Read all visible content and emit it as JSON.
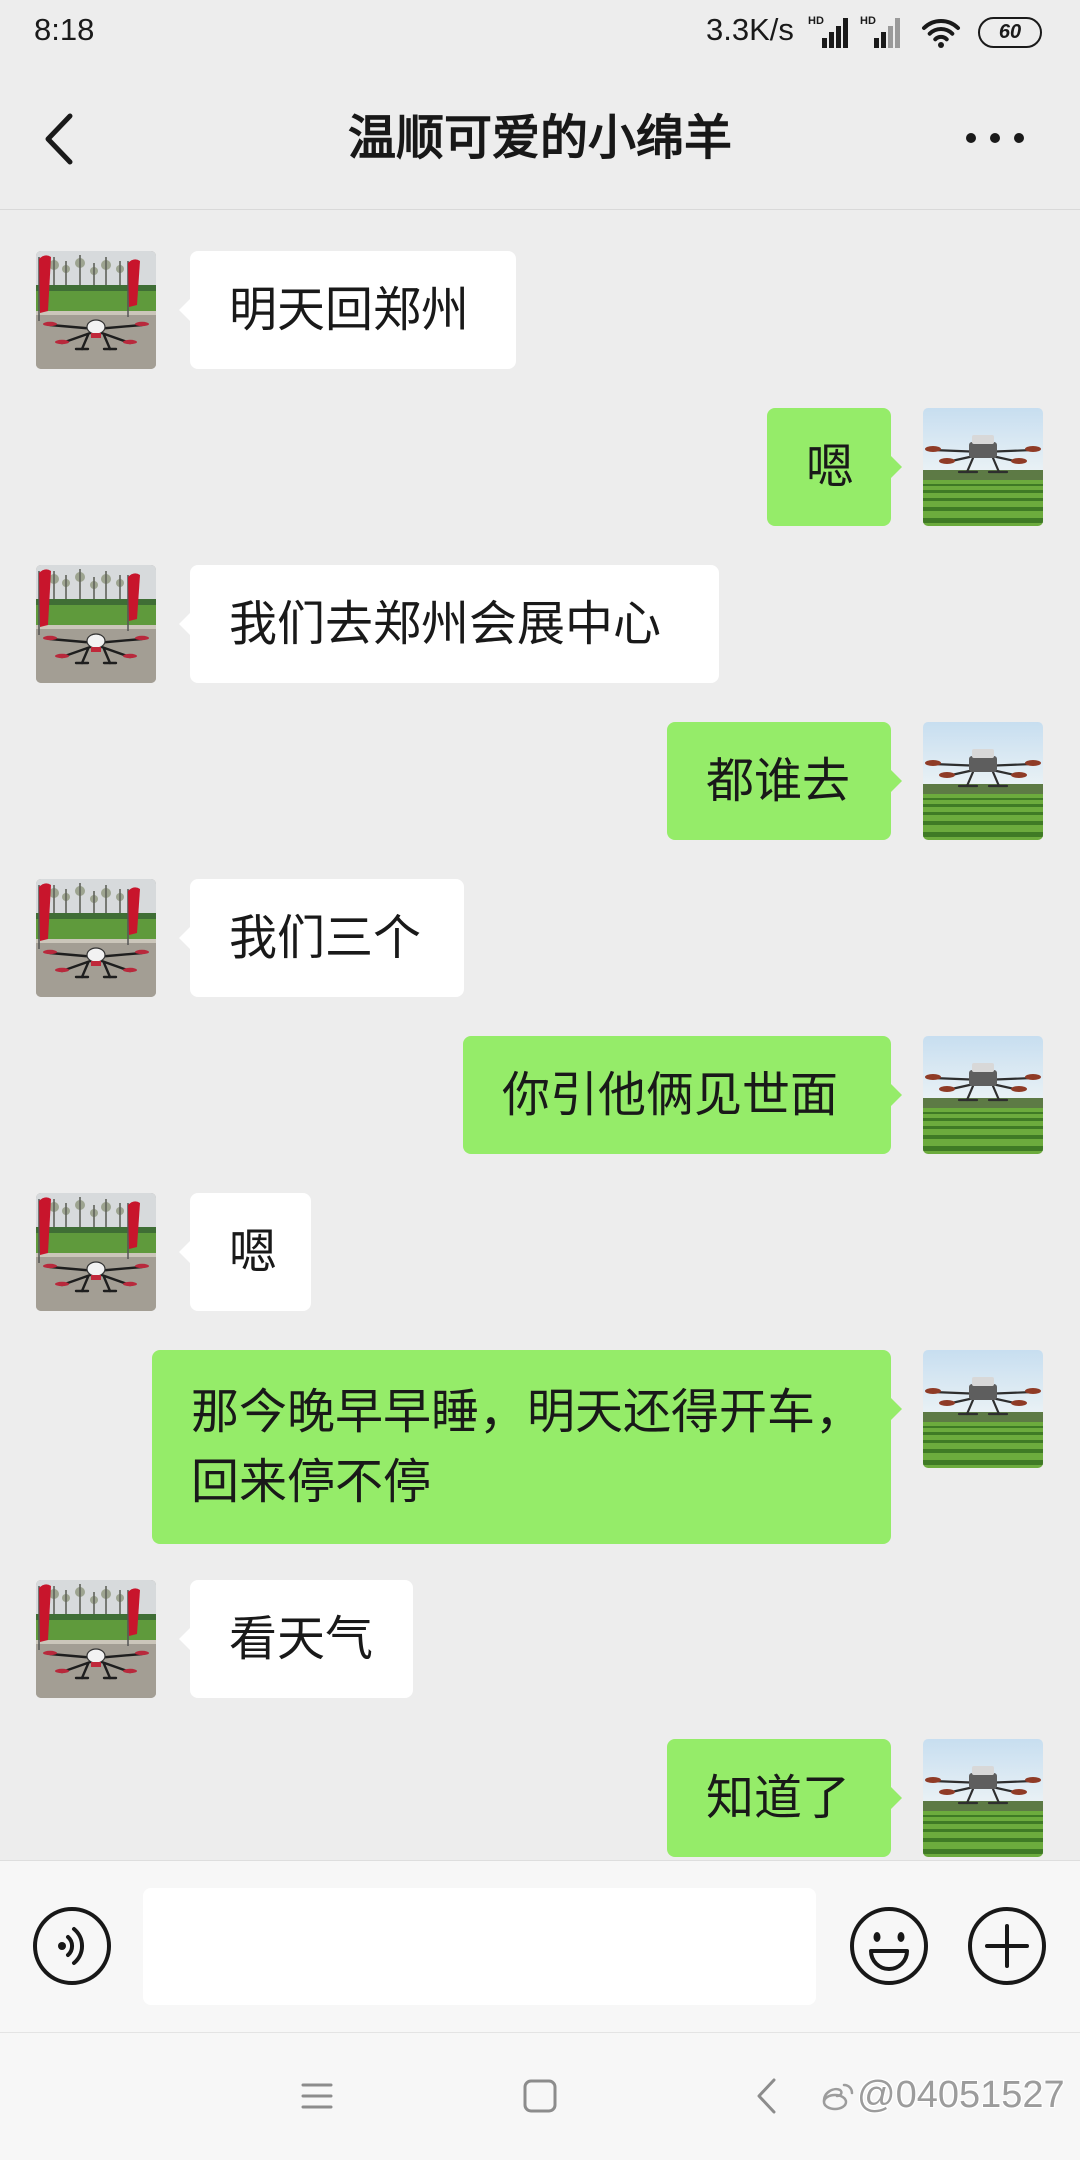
{
  "theme": {
    "chat_background": "#ededed",
    "incoming_bubble": "#ffffff",
    "outgoing_bubble": "#95ec69",
    "bar_background": "#f7f7f7"
  },
  "status_bar": {
    "time": "8:18",
    "net_speed": "3.3K/s",
    "sim1_label": "HD",
    "sim2_label": "HD",
    "wifi_icon": "wifi-icon",
    "battery_level": "60"
  },
  "header": {
    "back_icon": "back-chevron-icon",
    "title": "温顺可爱的小绵羊",
    "more_icon": "more-icon"
  },
  "messages": [
    {
      "avatar": "contact-avatar",
      "lines": [
        "明天回郑州"
      ]
    },
    {
      "avatar": "self-avatar",
      "lines": [
        "嗯"
      ]
    },
    {
      "avatar": "contact-avatar",
      "lines": [
        "我们去郑州会展中心"
      ]
    },
    {
      "avatar": "self-avatar",
      "lines": [
        "都谁去"
      ]
    },
    {
      "avatar": "contact-avatar",
      "lines": [
        "我们三个"
      ]
    },
    {
      "avatar": "self-avatar",
      "lines": [
        "你引他俩见世面"
      ]
    },
    {
      "avatar": "contact-avatar",
      "lines": [
        "嗯"
      ]
    },
    {
      "avatar": "self-avatar",
      "lines": [
        "那今晚早早睡，明天还得开车，",
        "回来停不停"
      ]
    },
    {
      "avatar": "contact-avatar",
      "lines": [
        "看天气"
      ]
    },
    {
      "avatar": "self-avatar",
      "lines": [
        "知道了"
      ]
    }
  ],
  "input_bar": {
    "voice_icon": "voice-icon",
    "value": "",
    "emoji_icon": "emoji-icon",
    "plus_icon": "plus-icon"
  },
  "nav_bar": {
    "menu_icon": "menu-icon",
    "home_icon": "home-icon",
    "back_icon": "back-icon"
  },
  "watermark": {
    "logo_icon": "weibo-logo-icon",
    "text": "@04051527"
  }
}
